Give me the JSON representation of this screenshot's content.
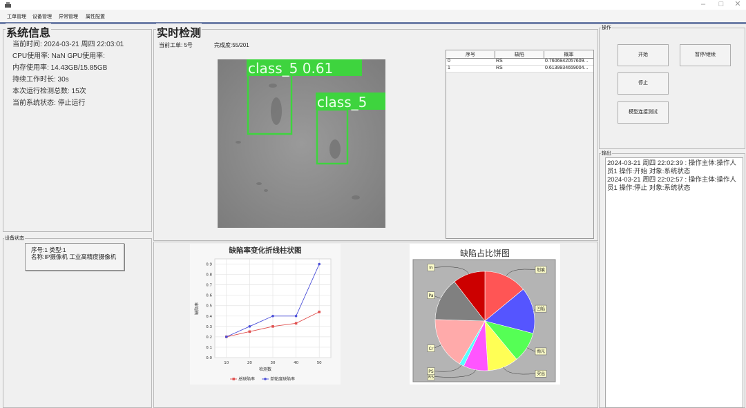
{
  "menu": [
    "工单管理",
    "设备管理",
    "异常管理",
    "属性配置"
  ],
  "system_info": {
    "title": "系统信息",
    "lines": [
      "当前时间: 2024-03-21 周四 22:03:01",
      "CPU使用率: NaN   GPU使用率:",
      "内存使用率: 14.43GB/15.85GB",
      "持续工作时长:  30s",
      "本次运行检测总数: 15次",
      "当前系统状态:  停止运行"
    ]
  },
  "device_status": {
    "title": "设备状态",
    "card_line1": "序号:1  类型:1",
    "card_line2": "名称:IP摄像机   工业高精度摄像机"
  },
  "realtime": {
    "title": "实时检测",
    "order_label": "当前工单:  5号",
    "progress_label": "完成度:55/201",
    "detections": [
      {
        "label": "class_5 0.61"
      },
      {
        "label": "class_5"
      }
    ],
    "table": {
      "headers": [
        "序号",
        "缺陷",
        "概率"
      ],
      "rows": [
        [
          "0",
          "RS",
          "0.7606942057609..."
        ],
        [
          "1",
          "RS",
          "0.6139934659004..."
        ]
      ]
    }
  },
  "operations": {
    "title": "操作",
    "start": "开始",
    "pause": "暂停/继续",
    "stop": "停止",
    "test": "模型连接测试"
  },
  "output": {
    "title": "输出",
    "lines": [
      "2024-03-21 周四 22:02:39 : 操作主体:操作人员1  操作:开始  对象:系统状态",
      "2024-03-21 周四 22:02:57 : 操作主体:操作人员1  操作:停止  对象:系统状态"
    ]
  },
  "line_chart": {
    "title": "缺陷率变化折线柱状图",
    "xlabel": "检测数",
    "ylabel": "缺陷率",
    "x": [
      10,
      20,
      30,
      40,
      50
    ],
    "ylim": [
      0,
      0.9
    ],
    "yticks": [
      "0.0",
      "0.1",
      "0.2",
      "0.3",
      "0.4",
      "0.5",
      "0.6",
      "0.7",
      "0.8",
      "0.9"
    ],
    "series": [
      {
        "name": "总缺陷率",
        "color": "#e0504f",
        "values": [
          0.2,
          0.25,
          0.3,
          0.33,
          0.44
        ]
      },
      {
        "name": "单轮度缺陷率",
        "color": "#4a4ed8",
        "values": [
          0.2,
          0.3,
          0.4,
          0.4,
          0.9
        ]
      }
    ]
  },
  "pie_chart": {
    "title": "缺陷占比饼图",
    "slices": [
      {
        "label": "划痕",
        "color": "#ff5555",
        "value": 14
      },
      {
        "label": "凹陷",
        "color": "#5555ff",
        "value": 15
      },
      {
        "label": "抛光",
        "color": "#55ff55",
        "value": 10
      },
      {
        "label": "突出",
        "color": "#ffff55",
        "value": 10
      },
      {
        "label": "RS",
        "color": "#ff55ff",
        "value": 8
      },
      {
        "label": "PS",
        "color": "#55ffff",
        "value": 1.5
      },
      {
        "label": "Cr",
        "color": "#ffaaaa",
        "value": 17
      },
      {
        "label": "Pa",
        "color": "#808080",
        "value": 14
      },
      {
        "label": "In",
        "color": "#cc0000",
        "value": 10.5
      }
    ]
  },
  "chart_data": [
    {
      "type": "line",
      "title": "缺陷率变化折线柱状图",
      "xlabel": "检测数",
      "ylabel": "缺陷率",
      "x": [
        10,
        20,
        30,
        40,
        50
      ],
      "ylim": [
        0,
        0.9
      ],
      "series": [
        {
          "name": "总缺陷率",
          "values": [
            0.2,
            0.25,
            0.3,
            0.33,
            0.44
          ]
        },
        {
          "name": "单轮度缺陷率",
          "values": [
            0.2,
            0.3,
            0.4,
            0.4,
            0.9
          ]
        }
      ],
      "legend": "bottom"
    },
    {
      "type": "pie",
      "title": "缺陷占比饼图",
      "categories": [
        "划痕",
        "凹陷",
        "抛光",
        "突出",
        "RS",
        "PS",
        "Cr",
        "Pa",
        "In"
      ],
      "values": [
        14,
        15,
        10,
        10,
        8,
        1.5,
        17,
        14,
        10.5
      ]
    }
  ]
}
